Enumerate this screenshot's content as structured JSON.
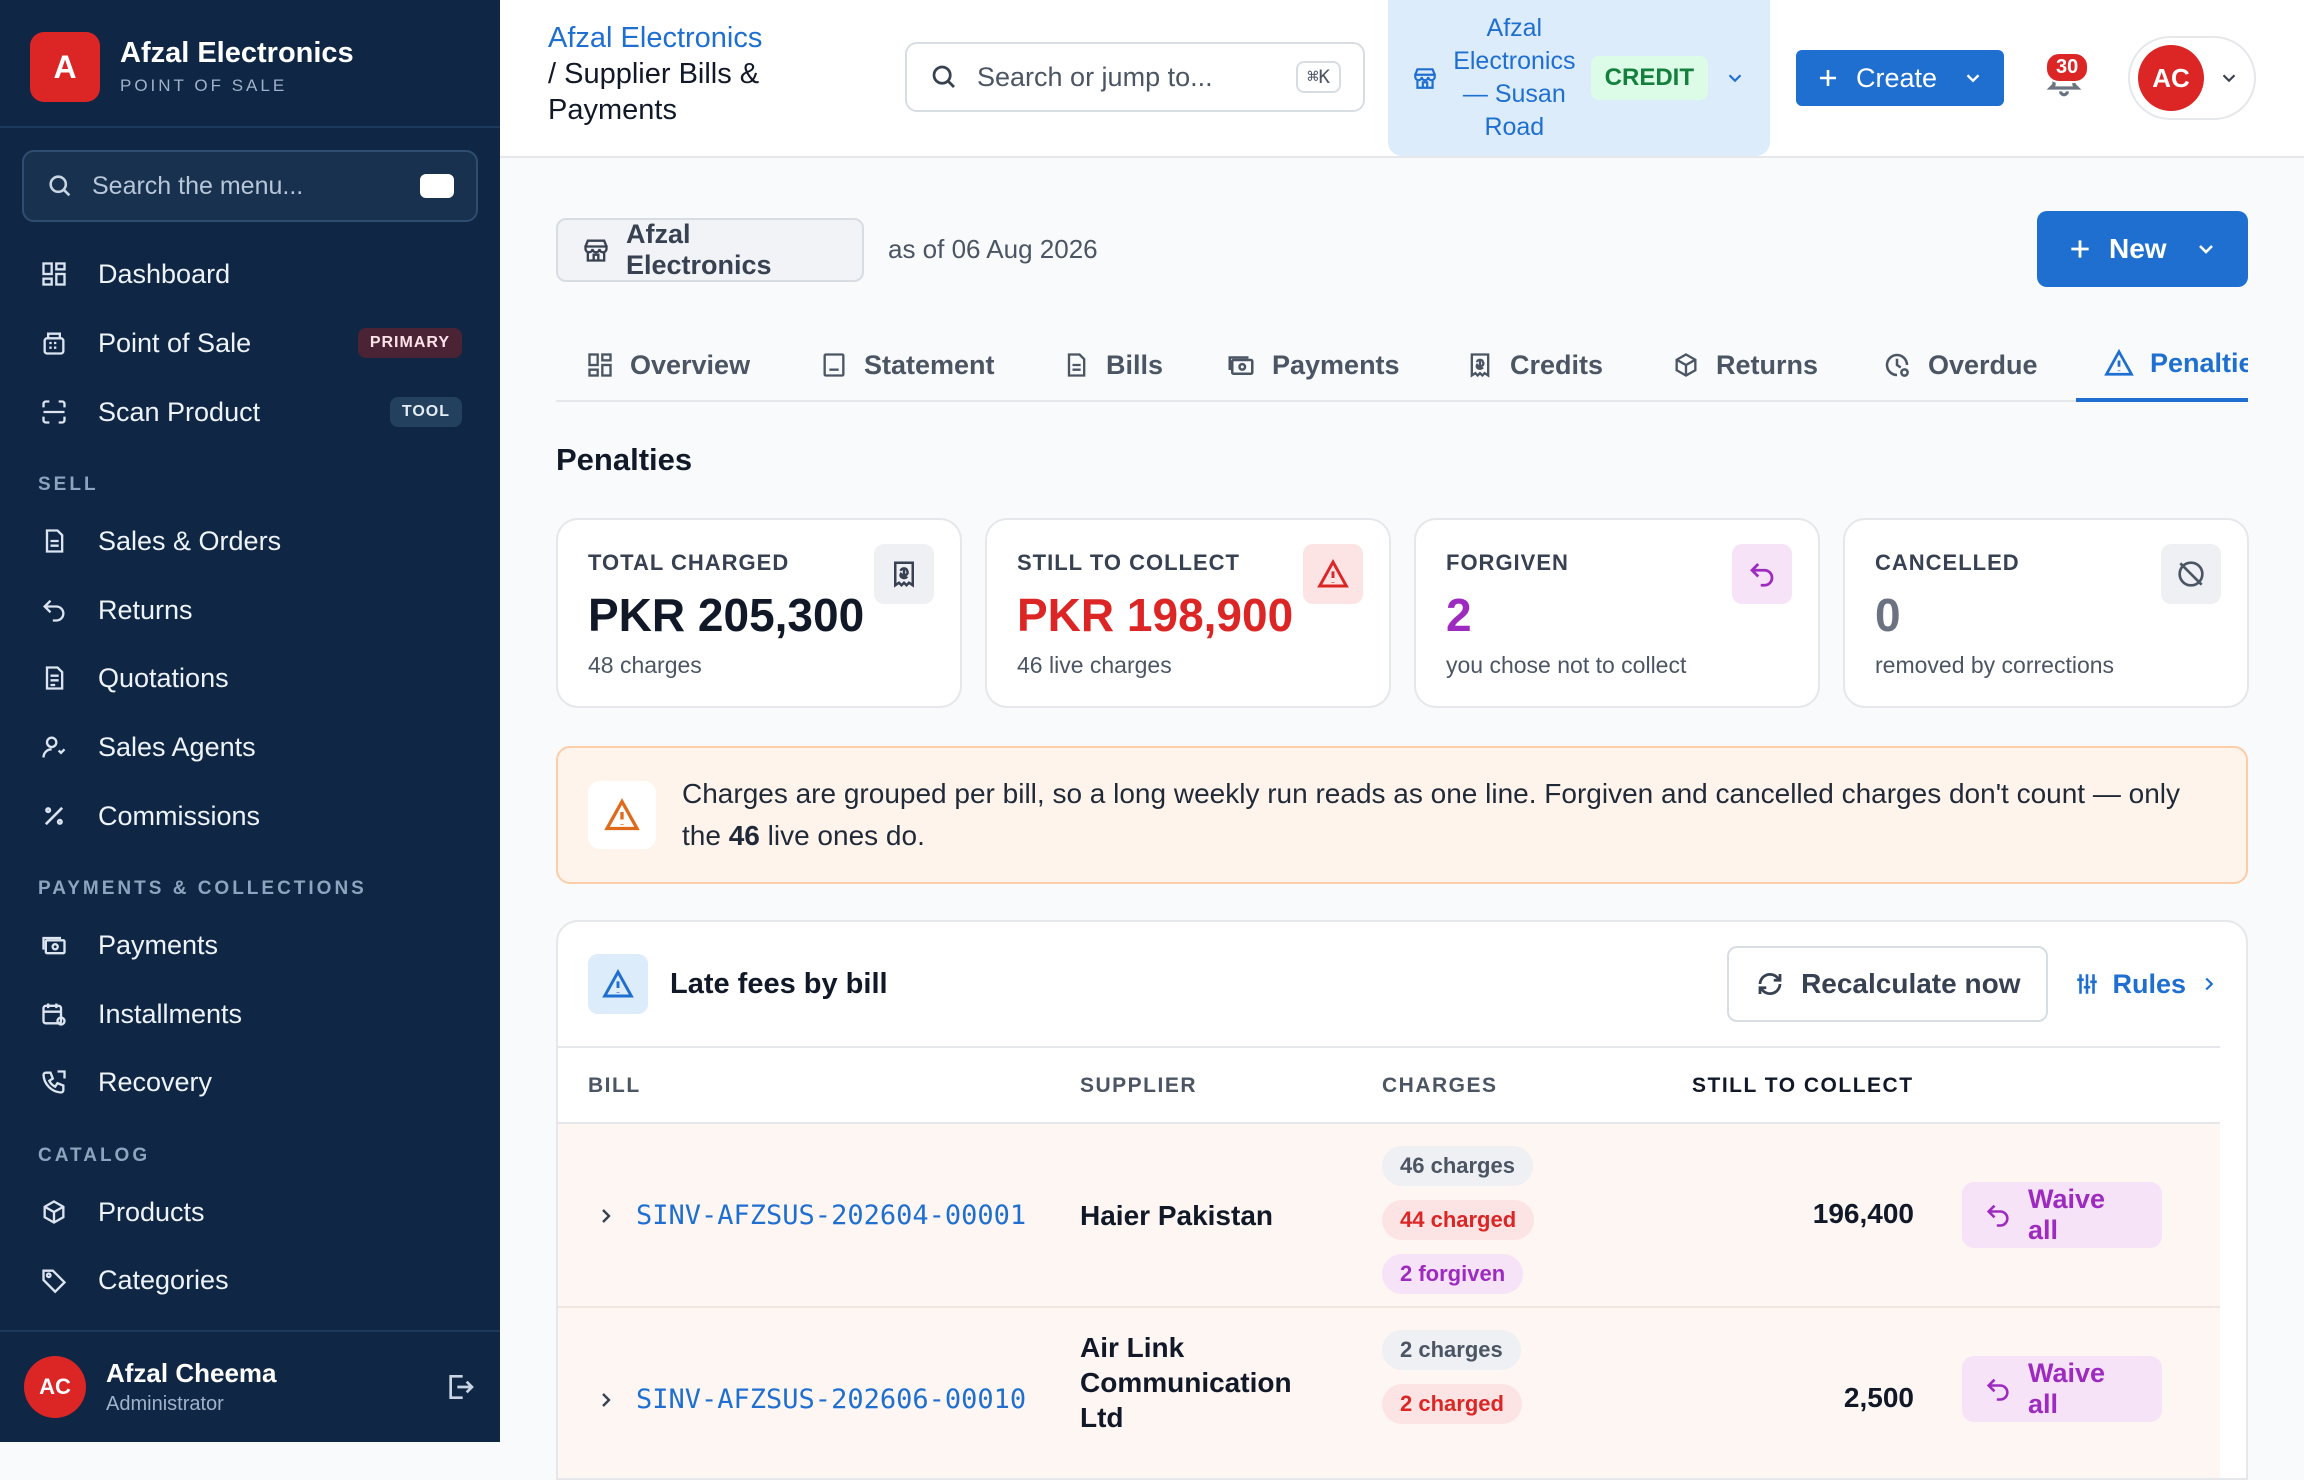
{
  "brand": {
    "initial": "A",
    "name": "Afzal Electronics",
    "sub": "POINT OF SALE"
  },
  "sidebar": {
    "search_placeholder": "Search the menu...",
    "items": [
      {
        "label": "Dashboard",
        "icon": "dashboard-icon"
      },
      {
        "label": "Point of Sale",
        "icon": "register-icon",
        "badge": "PRIMARY"
      },
      {
        "label": "Scan Product",
        "icon": "scan-icon",
        "badge": "TOOL"
      }
    ],
    "sections": [
      {
        "title": "SELL",
        "items": [
          {
            "label": "Sales & Orders",
            "icon": "document-icon"
          },
          {
            "label": "Returns",
            "icon": "return-icon"
          },
          {
            "label": "Quotations",
            "icon": "quotation-icon"
          },
          {
            "label": "Sales Agents",
            "icon": "user-icon"
          },
          {
            "label": "Commissions",
            "icon": "percent-icon"
          }
        ]
      },
      {
        "title": "PAYMENTS & COLLECTIONS",
        "items": [
          {
            "label": "Payments",
            "icon": "cash-icon"
          },
          {
            "label": "Installments",
            "icon": "calendar-icon"
          },
          {
            "label": "Recovery",
            "icon": "phone-icon"
          }
        ]
      },
      {
        "title": "CATALOG",
        "items": [
          {
            "label": "Products",
            "icon": "box-icon"
          },
          {
            "label": "Categories",
            "icon": "tag-icon"
          }
        ]
      }
    ],
    "user": {
      "initials": "AC",
      "name": "Afzal Cheema",
      "role": "Administrator"
    }
  },
  "header": {
    "breadcrumb_link": "Afzal Electronics",
    "breadcrumb_sep": "/",
    "page_title": "Supplier Bills & Payments",
    "search_placeholder": "Search or jump to...",
    "search_shortcut": "⌘K",
    "store_name": "Afzal Electronics — Susan Road",
    "store_badge": "CREDIT",
    "create_label": "Create",
    "notifications": "30",
    "avatar_initials": "AC"
  },
  "main": {
    "business_chip": "Afzal Electronics",
    "as_of": "as of 06 Aug 2026",
    "new_label": "New",
    "tabs": [
      {
        "label": "Overview",
        "icon": "grid-icon"
      },
      {
        "label": "Statement",
        "icon": "statement-icon"
      },
      {
        "label": "Bills",
        "icon": "bill-icon"
      },
      {
        "label": "Payments",
        "icon": "cash-icon"
      },
      {
        "label": "Credits",
        "icon": "receipt-icon"
      },
      {
        "label": "Returns",
        "icon": "box-return-icon"
      },
      {
        "label": "Overdue",
        "icon": "clock-icon"
      },
      {
        "label": "Penalties",
        "icon": "warning-icon",
        "active": true
      }
    ],
    "section_title": "Penalties",
    "stats": [
      {
        "label": "TOTAL CHARGED",
        "value": "PKR 205,300",
        "sub": "48 charges",
        "color": "#111827",
        "icon": "receipt-icon",
        "icon_bg": "#eef0f3"
      },
      {
        "label": "STILL TO COLLECT",
        "value": "PKR 198,900",
        "sub": "46 live charges",
        "color": "#dc2626",
        "icon": "warning-icon",
        "icon_bg": "#fde4e4"
      },
      {
        "label": "FORGIVEN",
        "value": "2",
        "sub": "you chose not to collect",
        "color": "#9d2bc0",
        "icon": "undo-icon",
        "icon_bg": "#f6e3f7"
      },
      {
        "label": "CANCELLED",
        "value": "0",
        "sub": "removed by corrections",
        "color": "#6b7280",
        "icon": "cancel-icon",
        "icon_bg": "#eef0f3"
      }
    ],
    "notice": {
      "before": "Charges are grouped per bill, so a long weekly run reads as one line. Forgiven and cancelled charges don't count — only the ",
      "count": "46",
      "after": " live ones do."
    },
    "panel": {
      "title": "Late fees by bill",
      "recalc_label": "Recalculate now",
      "rules_label": "Rules",
      "columns": [
        "BILL",
        "SUPPLIER",
        "CHARGES",
        "STILL TO COLLECT"
      ],
      "rows": [
        {
          "bill": "SINV-AFZSUS-202604-00001",
          "supplier": "Haier Pakistan",
          "charges": "46 charges",
          "charged": "44 charged",
          "forgiven": "2 forgiven",
          "still": "196,400",
          "action": "Waive all"
        },
        {
          "bill": "SINV-AFZSUS-202606-00010",
          "supplier": "Air Link Communication Ltd",
          "charges": "2 charges",
          "charged": "2 charged",
          "still": "2,500",
          "action": "Waive all"
        }
      ]
    }
  },
  "colors": {
    "sidebar_bg": "#0f2744",
    "accent": "#1f6fd1",
    "danger": "#dc2626",
    "forgiven": "#9d2bc0"
  }
}
